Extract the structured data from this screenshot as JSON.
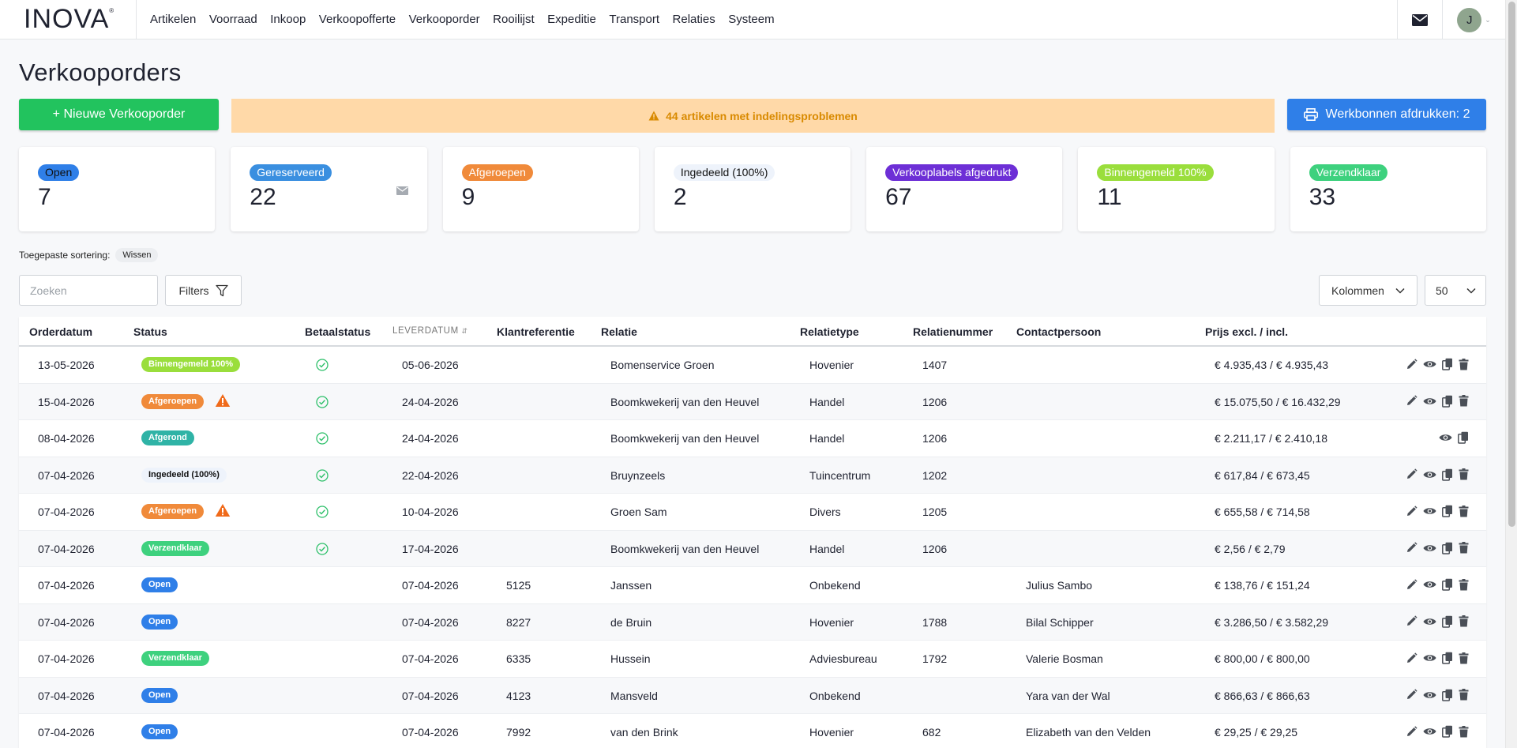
{
  "nav": {
    "logo": "INOVA",
    "logo_mark": "®",
    "items": [
      "Artikelen",
      "Voorraad",
      "Inkoop",
      "Verkoopofferte",
      "Verkooporder",
      "Rooilijst",
      "Expeditie",
      "Transport",
      "Relaties",
      "Systeem"
    ],
    "user_initial": "J"
  },
  "page": {
    "title": "Verkooporders",
    "new_button": "+ Nieuwe Verkooporder",
    "warning": "44 artikelen met indelingsproblemen",
    "print_button": "Werkbonnen afdrukken: 2"
  },
  "cards": [
    {
      "label": "Open",
      "count": "7",
      "color": "#2f7fe8",
      "text_color": "#111"
    },
    {
      "label": "Gereserveerd",
      "count": "22",
      "color": "#3a8fe0",
      "text_color": "#fff"
    },
    {
      "label": "Afgeroepen",
      "count": "9",
      "color": "#f08a3a",
      "text_color": "#fff"
    },
    {
      "label": "Ingedeeld (100%)",
      "count": "2",
      "color": "#eef3fb",
      "text_color": "#111"
    },
    {
      "label": "Verkooplabels afgedrukt",
      "count": "67",
      "color": "#6d2fd6",
      "text_color": "#fff"
    },
    {
      "label": "Binnengemeld 100%",
      "count": "11",
      "color": "#9ade3c",
      "text_color": "#fff"
    },
    {
      "label": "Verzendklaar",
      "count": "33",
      "color": "#3ed17e",
      "text_color": "#fff"
    }
  ],
  "sorting": {
    "label": "Toegepaste sortering:",
    "clear": "Wissen"
  },
  "toolbar": {
    "search_placeholder": "Zoeken",
    "filters": "Filters",
    "columns": "Kolommen",
    "per_page": "50"
  },
  "table": {
    "headers": {
      "orderdatum": "Orderdatum",
      "status": "Status",
      "betaalstatus": "Betaalstatus",
      "leverdatum": "LEVERDATUM",
      "klantreferentie": "Klantreferentie",
      "relatie": "Relatie",
      "relatietype": "Relatietype",
      "relatienummer": "Relatienummer",
      "contactpersoon": "Contactpersoon",
      "prijs": "Prijs excl. / incl."
    },
    "status_colors": {
      "Binnengemeld 100%": "#9ade3c",
      "Afgeroepen": "#f08a3a",
      "Afgerond": "#2fb3a6",
      "Ingedeeld (100%)": "#eef3fb",
      "Verzendklaar": "#3ed17e",
      "Open": "#2f7fe8"
    },
    "rows": [
      {
        "orderdatum": "13-05-2026",
        "status": "Binnengemeld 100%",
        "warning": false,
        "paid": true,
        "leverdatum": "05-06-2026",
        "klantreferentie": "",
        "relatie": "Bomenservice Groen",
        "relatietype": "Hovenier",
        "relatienummer": "1407",
        "contactpersoon": "",
        "prijs": "€ 4.935,43 / € 4.935,43",
        "editable": true
      },
      {
        "orderdatum": "15-04-2026",
        "status": "Afgeroepen",
        "warning": true,
        "paid": true,
        "leverdatum": "24-04-2026",
        "klantreferentie": "",
        "relatie": "Boomkwekerij van den Heuvel",
        "relatietype": "Handel",
        "relatienummer": "1206",
        "contactpersoon": "",
        "prijs": "€ 15.075,50 / € 16.432,29",
        "editable": true
      },
      {
        "orderdatum": "08-04-2026",
        "status": "Afgerond",
        "warning": false,
        "paid": true,
        "leverdatum": "24-04-2026",
        "klantreferentie": "",
        "relatie": "Boomkwekerij van den Heuvel",
        "relatietype": "Handel",
        "relatienummer": "1206",
        "contactpersoon": "",
        "prijs": "€ 2.211,17 / € 2.410,18",
        "editable": false
      },
      {
        "orderdatum": "07-04-2026",
        "status": "Ingedeeld (100%)",
        "warning": false,
        "paid": true,
        "leverdatum": "22-04-2026",
        "klantreferentie": "",
        "relatie": "Bruynzeels",
        "relatietype": "Tuincentrum",
        "relatienummer": "1202",
        "contactpersoon": "",
        "prijs": "€ 617,84 / € 673,45",
        "editable": true
      },
      {
        "orderdatum": "07-04-2026",
        "status": "Afgeroepen",
        "warning": true,
        "paid": true,
        "leverdatum": "10-04-2026",
        "klantreferentie": "",
        "relatie": "Groen Sam",
        "relatietype": "Divers",
        "relatienummer": "1205",
        "contactpersoon": "",
        "prijs": "€ 655,58 / € 714,58",
        "editable": true
      },
      {
        "orderdatum": "07-04-2026",
        "status": "Verzendklaar",
        "warning": false,
        "paid": true,
        "leverdatum": "17-04-2026",
        "klantreferentie": "",
        "relatie": "Boomkwekerij van den Heuvel",
        "relatietype": "Handel",
        "relatienummer": "1206",
        "contactpersoon": "",
        "prijs": "€ 2,56 / € 2,79",
        "editable": true
      },
      {
        "orderdatum": "07-04-2026",
        "status": "Open",
        "warning": false,
        "paid": false,
        "leverdatum": "07-04-2026",
        "klantreferentie": "5125",
        "relatie": "Janssen",
        "relatietype": "Onbekend",
        "relatienummer": "",
        "contactpersoon": "Julius Sambo",
        "prijs": "€ 138,76 / € 151,24",
        "editable": true
      },
      {
        "orderdatum": "07-04-2026",
        "status": "Open",
        "warning": false,
        "paid": false,
        "leverdatum": "07-04-2026",
        "klantreferentie": "8227",
        "relatie": "de Bruin",
        "relatietype": "Hovenier",
        "relatienummer": "1788",
        "contactpersoon": "Bilal Schipper",
        "prijs": "€ 3.286,50 / € 3.582,29",
        "editable": true
      },
      {
        "orderdatum": "07-04-2026",
        "status": "Verzendklaar",
        "warning": false,
        "paid": false,
        "leverdatum": "07-04-2026",
        "klantreferentie": "6335",
        "relatie": "Hussein",
        "relatietype": "Adviesbureau",
        "relatienummer": "1792",
        "contactpersoon": "Valerie Bosman",
        "prijs": "€ 800,00 / € 800,00",
        "editable": true
      },
      {
        "orderdatum": "07-04-2026",
        "status": "Open",
        "warning": false,
        "paid": false,
        "leverdatum": "07-04-2026",
        "klantreferentie": "4123",
        "relatie": "Mansveld",
        "relatietype": "Onbekend",
        "relatienummer": "",
        "contactpersoon": "Yara van der Wal",
        "prijs": "€ 866,63 / € 866,63",
        "editable": true
      },
      {
        "orderdatum": "07-04-2026",
        "status": "Open",
        "warning": false,
        "paid": false,
        "leverdatum": "07-04-2026",
        "klantreferentie": "7992",
        "relatie": "van den Brink",
        "relatietype": "Hovenier",
        "relatienummer": "682",
        "contactpersoon": "Elizabeth van den Velden",
        "prijs": "€ 29,25 / € 29,25",
        "editable": true
      }
    ]
  }
}
